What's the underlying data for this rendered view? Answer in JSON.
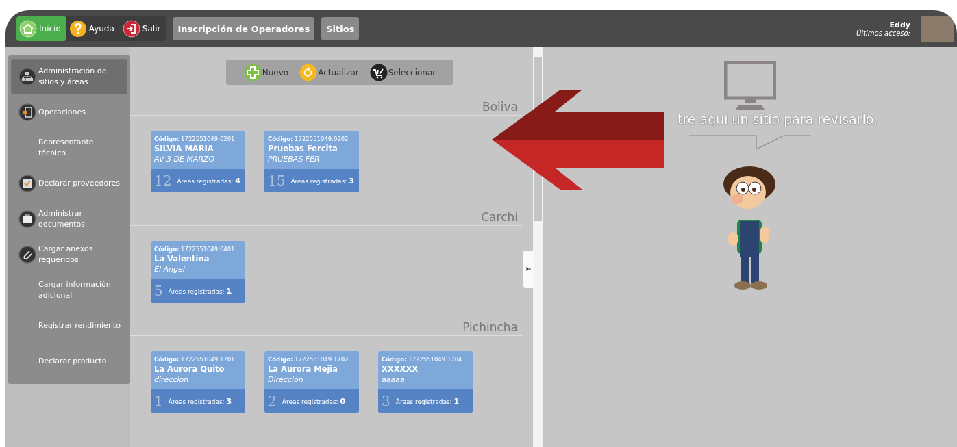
{
  "topbar": {
    "nav": [
      {
        "label": "Inicio",
        "kind": "home",
        "selected": true
      },
      {
        "label": "Ayuda",
        "kind": "help",
        "selected": false
      },
      {
        "label": "Salir",
        "kind": "exit",
        "selected": false
      }
    ],
    "tabs": [
      {
        "label": "Inscripción de Operadores"
      },
      {
        "label": "Sitios"
      }
    ],
    "user": {
      "name": "Eddy",
      "last_access": "Últimos acceso:"
    }
  },
  "sidebar": {
    "items": [
      {
        "label": "Administración de sitios y áreas",
        "kind": "sitemap",
        "selected": true
      },
      {
        "label": "Operaciones",
        "kind": "operations",
        "selected": false
      },
      {
        "label": "Representante técnico",
        "kind": "plain",
        "selected": false
      },
      {
        "label": "Declarar proveedores",
        "kind": "check",
        "selected": false
      },
      {
        "label": "Administrar documentos",
        "kind": "briefcase",
        "selected": false
      },
      {
        "label": "Cargar anexos requeridos",
        "kind": "paperclip",
        "selected": false
      },
      {
        "label": "Cargar información adicional",
        "kind": "plain",
        "selected": false
      },
      {
        "label": "Registrar rendimiento",
        "kind": "plain",
        "selected": false
      },
      {
        "label": "Declarar producto",
        "kind": "plain",
        "selected": false
      }
    ]
  },
  "toolbar": [
    {
      "label": "Nuevo",
      "kind": "add"
    },
    {
      "label": "Actualizar",
      "kind": "refresh"
    },
    {
      "label": "Seleccionar",
      "kind": "select"
    }
  ],
  "groups": [
    {
      "name": "Boliva",
      "sites": [
        {
          "code_label": "Código:",
          "code": "1722551049.0201",
          "name": "SILVIA MARIA",
          "address": "AV 3 DE MARZO",
          "number": "12",
          "areas_label": "Áreas registradas:",
          "areas": "4"
        },
        {
          "code_label": "Código:",
          "code": "1722551049.0202",
          "name": "Pruebas Fercita",
          "address": "PRUEBAS FER",
          "number": "15",
          "areas_label": "Áreas registradas:",
          "areas": "3"
        }
      ]
    },
    {
      "name": "Carchi",
      "sites": [
        {
          "code_label": "Código:",
          "code": "1722551049.0401",
          "name": "La Valentina",
          "address": "El Angel",
          "number": "5",
          "areas_label": "Áreas registradas:",
          "areas": "1"
        }
      ]
    },
    {
      "name": "Pichincha",
      "sites": [
        {
          "code_label": "Código:",
          "code": "1722551049.1701",
          "name": "La Aurora Quito",
          "address": "direccion",
          "number": "1",
          "areas_label": "Áreas registradas:",
          "areas": "3"
        },
        {
          "code_label": "Código:",
          "code": "1722551049.1702",
          "name": "La Aurora Mejia",
          "address": "Dirección",
          "number": "2",
          "areas_label": "Áreas registradas:",
          "areas": "0"
        },
        {
          "code_label": "Código:",
          "code": "1722551049.1704",
          "name": "XXXXXX",
          "address": "aaaaa",
          "number": "3",
          "areas_label": "Áreas registradas:",
          "areas": "1"
        }
      ]
    }
  ],
  "detail": {
    "message": "tre aqui un sitio para revisarlo."
  }
}
